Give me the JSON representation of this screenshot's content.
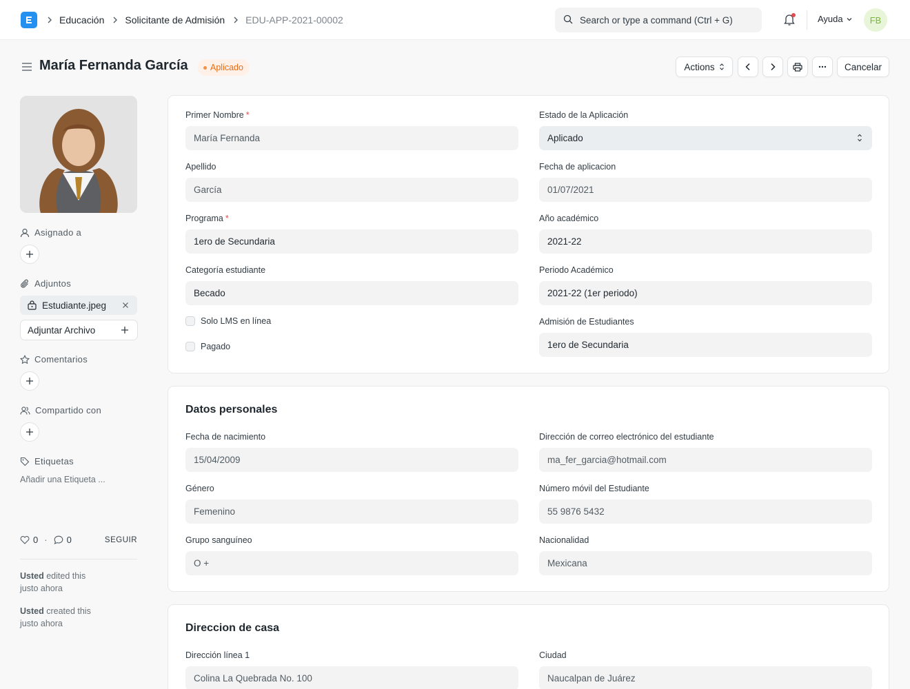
{
  "navbar": {
    "breadcrumbs": [
      "Educación",
      "Solicitante de Admisión",
      "EDU-APP-2021-00002"
    ],
    "search_placeholder": "Search or type a command (Ctrl + G)",
    "help_label": "Ayuda",
    "avatar_initials": "FB"
  },
  "page": {
    "title": "María Fernanda García",
    "status": "Aplicado",
    "actions_label": "Actions",
    "cancel_label": "Cancelar"
  },
  "sidebar": {
    "assigned_label": "Asignado a",
    "attachments_label": "Adjuntos",
    "attachment_file": "Estudiante.jpeg",
    "attach_button": "Adjuntar Archivo",
    "comments_label": "Comentarios",
    "shared_label": "Compartido con",
    "tags_label": "Etiquetas",
    "add_tag": "Añadir una Etiqueta ...",
    "likes": "0",
    "comment_count": "0",
    "follow_label": "SEGUIR",
    "activity": [
      {
        "user": "Usted",
        "action": "edited this",
        "time": "justo ahora"
      },
      {
        "user": "Usted",
        "action": "created this",
        "time": "justo ahora"
      }
    ]
  },
  "main": {
    "first_name": {
      "label": "Primer Nombre",
      "value": "María Fernanda"
    },
    "last_name": {
      "label": "Apellido",
      "value": "García"
    },
    "program": {
      "label": "Programa",
      "value": "1ero de Secundaria"
    },
    "student_category": {
      "label": "Categoría estudiante",
      "value": "Becado"
    },
    "lms_only": {
      "label": "Solo LMS en línea"
    },
    "paid": {
      "label": "Pagado"
    },
    "application_status": {
      "label": "Estado de la Aplicación",
      "value": "Aplicado"
    },
    "application_date": {
      "label": "Fecha de aplicacion",
      "value": "01/07/2021"
    },
    "academic_year": {
      "label": "Año académico",
      "value": "2021-22"
    },
    "academic_term": {
      "label": "Periodo Académico",
      "value": "2021-22 (1er periodo)"
    },
    "student_admission": {
      "label": "Admisión de Estudiantes",
      "value": "1ero de Secundaria"
    }
  },
  "personal": {
    "title": "Datos personales",
    "dob": {
      "label": "Fecha de nacimiento",
      "value": "15/04/2009"
    },
    "gender": {
      "label": "Género",
      "value": "Femenino"
    },
    "blood_group": {
      "label": "Grupo sanguíneo",
      "value": "O +"
    },
    "email": {
      "label": "Dirección de correo electrónico del estudiante",
      "value": "ma_fer_garcia@hotmail.com"
    },
    "mobile": {
      "label": "Número móvil del Estudiante",
      "value": "55 9876 5432"
    },
    "nationality": {
      "label": "Nacionalidad",
      "value": "Mexicana"
    }
  },
  "address": {
    "title": "Direccion de casa",
    "line1": {
      "label": "Dirección línea 1",
      "value": "Colina La Quebrada No. 100"
    },
    "city": {
      "label": "Ciudad",
      "value": "Naucalpan de Juárez"
    }
  }
}
